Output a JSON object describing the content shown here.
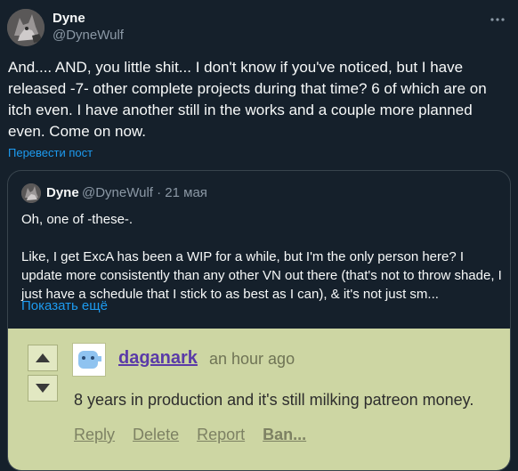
{
  "post": {
    "display_name": "Dyne",
    "handle": "@DyneWulf",
    "more_icon": "more-horizontal-icon",
    "text": "And.... AND, you little shit...  I don't know if you've noticed, but I have released -7- other complete projects during that time?  6 of which are on itch even.  I have another still in the works and a couple more planned even.  Come on now.",
    "translate_label": "Перевести пост"
  },
  "quote": {
    "display_name": "Dyne",
    "meta": "@DyneWulf · 21 мая",
    "line1": "Oh, one of -these-.",
    "line2": "Like, I get ExcA has been a WIP for a while, but I'm the only person here? I update more consistently than any other VN out there (that's not to throw shade, I just have a schedule that I stick to as best as I can), & it's not just sm...",
    "show_more": "Показать ещё"
  },
  "embedded_comment": {
    "username": "daganark",
    "time": "an hour ago",
    "body": "8 years in production and it's still milking patreon money.",
    "actions": [
      "Reply",
      "Delete",
      "Report",
      "Ban..."
    ],
    "colors": {
      "background": "#cdd6a3",
      "username": "#5a3aa8",
      "muted": "#7d8163"
    }
  },
  "colors": {
    "background": "#15202b",
    "accent": "#1d9bf0",
    "secondary_text": "#8b98a5",
    "border": "#38444d"
  }
}
